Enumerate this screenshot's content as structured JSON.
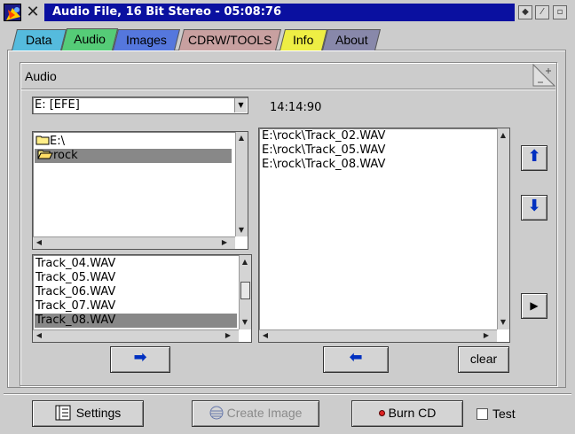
{
  "window": {
    "title": "Audio File, 16 Bit Stereo - 05:08:76",
    "close_glyph": "✕",
    "controls": [
      "◆",
      "⁄",
      "▫"
    ]
  },
  "tabs": [
    {
      "label": "Data",
      "color": "#55bbdd"
    },
    {
      "label": "Audio",
      "color": "#55cc77",
      "active": true
    },
    {
      "label": "Images",
      "color": "#5577dd"
    },
    {
      "label": "CDRW/TOOLS",
      "color": "#c8a0a0"
    },
    {
      "label": "Info",
      "color": "#eeee44"
    },
    {
      "label": "About",
      "color": "#8888aa"
    }
  ],
  "audio": {
    "group_title": "Audio",
    "drive_select": "E: [EFE]",
    "total_time": "14:14:90",
    "folder_tree": [
      {
        "label": "E:\\",
        "icon": "folder-icon",
        "selected": false
      },
      {
        "label": "rock",
        "icon": "folder-open-icon",
        "selected": true
      }
    ],
    "file_list": [
      {
        "label": "Track_04.WAV",
        "selected": false
      },
      {
        "label": "Track_05.WAV",
        "selected": false
      },
      {
        "label": "Track_06.WAV",
        "selected": false
      },
      {
        "label": "Track_07.WAV",
        "selected": false
      },
      {
        "label": "Track_08.WAV",
        "selected": true
      }
    ],
    "compilation": [
      "E:\\rock\\Track_02.WAV",
      "E:\\rock\\Track_05.WAV",
      "E:\\rock\\Track_08.WAV"
    ],
    "add_button": "➡",
    "remove_button": "⬅",
    "clear_label": "clear",
    "move_up": "⬆",
    "move_down": "⬇",
    "play": "▶"
  },
  "footer": {
    "settings_label": "Settings",
    "create_image_label": "Create Image",
    "burn_label": "Burn CD",
    "test_label": "Test",
    "test_checked": false
  }
}
